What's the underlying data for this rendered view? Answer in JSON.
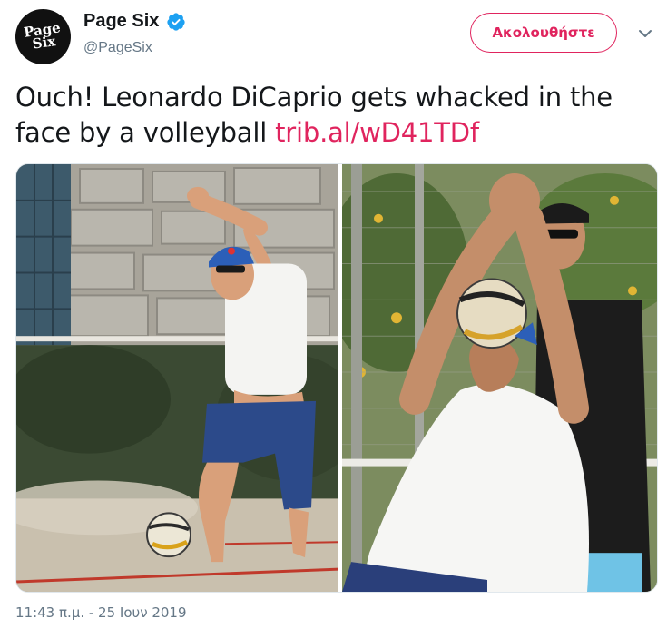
{
  "author": {
    "avatar_text_line1": "Page",
    "avatar_text_line2": "Six",
    "display_name": "Page Six",
    "handle": "@PageSix",
    "verified": true
  },
  "follow_label": "Ακολουθήστε",
  "tweet": {
    "text": "Ouch! Leonardo DiCaprio gets whacked in the face by a volleyball",
    "link": "trib.al/wD41TDf",
    "timestamp": "11:43 π.μ. - 25 Ιουν 2019"
  },
  "icons": {
    "verified": "verified-badge-icon",
    "caret": "chevron-down-icon"
  },
  "colors": {
    "accent": "#e0245e",
    "verified": "#1da1f2",
    "secondary_text": "#657786"
  }
}
